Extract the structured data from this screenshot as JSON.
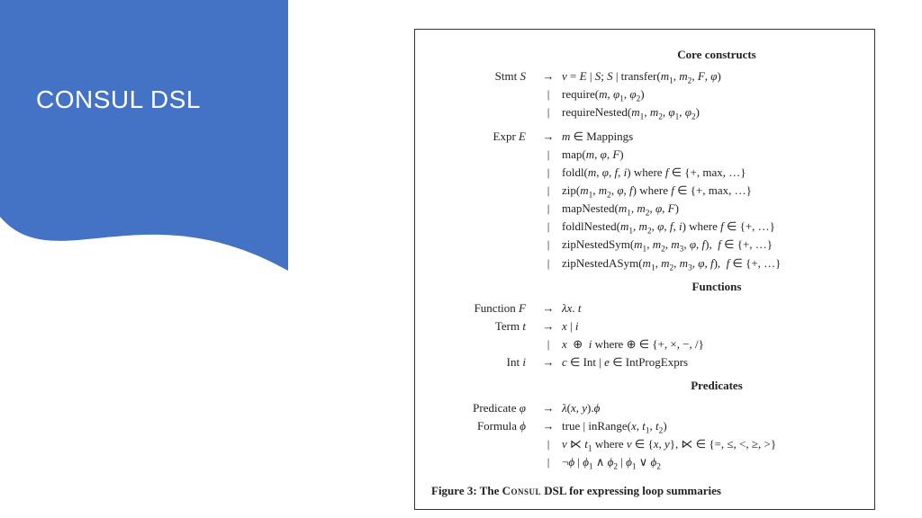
{
  "sidebar": {
    "title": "CONSUL DSL",
    "bg_color": "#4472C4"
  },
  "figure": {
    "sections": {
      "core": "Core constructs",
      "functions": "Functions",
      "predicates": "Predicates"
    },
    "grammar": {
      "stmt": {
        "lhs": "Stmt S",
        "rows": [
          "v = E | S; S | transfer(m₁, m₂, F, φ)",
          "require(m, φ₁, φ₂)",
          "requireNested(m₁, m₂, φ₁, φ₂)"
        ]
      },
      "expr": {
        "lhs": "Expr E",
        "rows": [
          "m ∈ Mappings",
          "map(m, φ, F)",
          "foldl(m, φ, f, i) where f ∈ {+, max, …}",
          "zip(m₁, m₂, φ, f) where f ∈ {+, max, …}",
          "mapNested(m₁, m₂, φ, F)",
          "foldlNested(m₁, m₂, φ, f, i) where f ∈ {+, …}",
          "zipNestedSym(m₁, m₂, m₃, φ, f),  f ∈ {+, …}",
          "zipNestedASym(m₁, m₂, m₃, φ, f),  f ∈ {+, …}"
        ]
      },
      "function": {
        "lhs": "Function F",
        "rhs": "λx. t"
      },
      "term": {
        "lhs": "Term t",
        "rows": [
          "x | i",
          "x ⊕ i where ⊕ ∈ {+, ×, −, /}"
        ]
      },
      "int": {
        "lhs": "Int i",
        "rhs": "c ∈ Int | e ∈ IntProgExprs"
      },
      "predicate": {
        "lhs": "Predicate φ",
        "rhs": "λ(x, y).ϕ"
      },
      "formula": {
        "lhs": "Formula ϕ",
        "rows": [
          "true | inRange(x, t₁, t₂)",
          "v ⋉ t₁ where v ∈ {x, y}, ⋉ ∈ {=, ≤, <, ≥, >}",
          "¬ϕ | ϕ₁ ∧ ϕ₂ | ϕ₁ ∨ ϕ₂"
        ]
      }
    },
    "caption_prefix": "Figure 3: The ",
    "caption_name": "Consul",
    "caption_suffix": " DSL for expressing loop summaries"
  }
}
